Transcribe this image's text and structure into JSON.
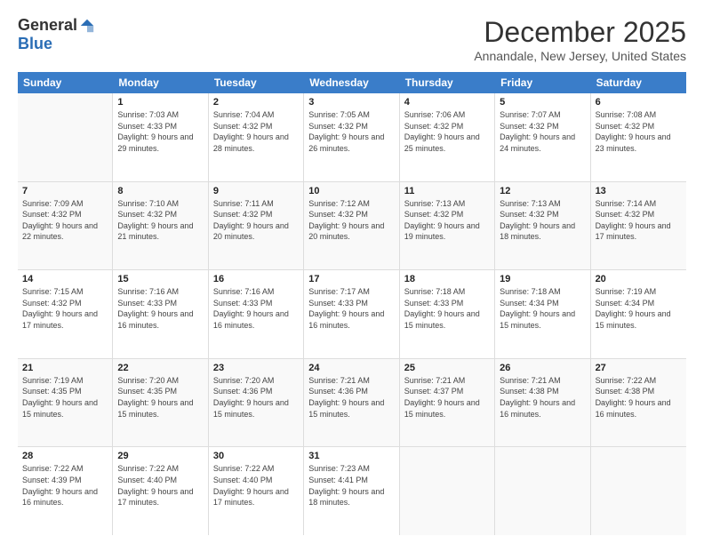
{
  "logo": {
    "general": "General",
    "blue": "Blue"
  },
  "title": "December 2025",
  "location": "Annandale, New Jersey, United States",
  "days_of_week": [
    "Sunday",
    "Monday",
    "Tuesday",
    "Wednesday",
    "Thursday",
    "Friday",
    "Saturday"
  ],
  "weeks": [
    [
      {
        "day": "",
        "sunrise": "",
        "sunset": "",
        "daylight": ""
      },
      {
        "day": "1",
        "sunrise": "7:03 AM",
        "sunset": "4:33 PM",
        "daylight": "9 hours and 29 minutes."
      },
      {
        "day": "2",
        "sunrise": "7:04 AM",
        "sunset": "4:32 PM",
        "daylight": "9 hours and 28 minutes."
      },
      {
        "day": "3",
        "sunrise": "7:05 AM",
        "sunset": "4:32 PM",
        "daylight": "9 hours and 26 minutes."
      },
      {
        "day": "4",
        "sunrise": "7:06 AM",
        "sunset": "4:32 PM",
        "daylight": "9 hours and 25 minutes."
      },
      {
        "day": "5",
        "sunrise": "7:07 AM",
        "sunset": "4:32 PM",
        "daylight": "9 hours and 24 minutes."
      },
      {
        "day": "6",
        "sunrise": "7:08 AM",
        "sunset": "4:32 PM",
        "daylight": "9 hours and 23 minutes."
      }
    ],
    [
      {
        "day": "7",
        "sunrise": "7:09 AM",
        "sunset": "4:32 PM",
        "daylight": "9 hours and 22 minutes."
      },
      {
        "day": "8",
        "sunrise": "7:10 AM",
        "sunset": "4:32 PM",
        "daylight": "9 hours and 21 minutes."
      },
      {
        "day": "9",
        "sunrise": "7:11 AM",
        "sunset": "4:32 PM",
        "daylight": "9 hours and 20 minutes."
      },
      {
        "day": "10",
        "sunrise": "7:12 AM",
        "sunset": "4:32 PM",
        "daylight": "9 hours and 20 minutes."
      },
      {
        "day": "11",
        "sunrise": "7:13 AM",
        "sunset": "4:32 PM",
        "daylight": "9 hours and 19 minutes."
      },
      {
        "day": "12",
        "sunrise": "7:13 AM",
        "sunset": "4:32 PM",
        "daylight": "9 hours and 18 minutes."
      },
      {
        "day": "13",
        "sunrise": "7:14 AM",
        "sunset": "4:32 PM",
        "daylight": "9 hours and 17 minutes."
      }
    ],
    [
      {
        "day": "14",
        "sunrise": "7:15 AM",
        "sunset": "4:32 PM",
        "daylight": "9 hours and 17 minutes."
      },
      {
        "day": "15",
        "sunrise": "7:16 AM",
        "sunset": "4:33 PM",
        "daylight": "9 hours and 16 minutes."
      },
      {
        "day": "16",
        "sunrise": "7:16 AM",
        "sunset": "4:33 PM",
        "daylight": "9 hours and 16 minutes."
      },
      {
        "day": "17",
        "sunrise": "7:17 AM",
        "sunset": "4:33 PM",
        "daylight": "9 hours and 16 minutes."
      },
      {
        "day": "18",
        "sunrise": "7:18 AM",
        "sunset": "4:33 PM",
        "daylight": "9 hours and 15 minutes."
      },
      {
        "day": "19",
        "sunrise": "7:18 AM",
        "sunset": "4:34 PM",
        "daylight": "9 hours and 15 minutes."
      },
      {
        "day": "20",
        "sunrise": "7:19 AM",
        "sunset": "4:34 PM",
        "daylight": "9 hours and 15 minutes."
      }
    ],
    [
      {
        "day": "21",
        "sunrise": "7:19 AM",
        "sunset": "4:35 PM",
        "daylight": "9 hours and 15 minutes."
      },
      {
        "day": "22",
        "sunrise": "7:20 AM",
        "sunset": "4:35 PM",
        "daylight": "9 hours and 15 minutes."
      },
      {
        "day": "23",
        "sunrise": "7:20 AM",
        "sunset": "4:36 PM",
        "daylight": "9 hours and 15 minutes."
      },
      {
        "day": "24",
        "sunrise": "7:21 AM",
        "sunset": "4:36 PM",
        "daylight": "9 hours and 15 minutes."
      },
      {
        "day": "25",
        "sunrise": "7:21 AM",
        "sunset": "4:37 PM",
        "daylight": "9 hours and 15 minutes."
      },
      {
        "day": "26",
        "sunrise": "7:21 AM",
        "sunset": "4:38 PM",
        "daylight": "9 hours and 16 minutes."
      },
      {
        "day": "27",
        "sunrise": "7:22 AM",
        "sunset": "4:38 PM",
        "daylight": "9 hours and 16 minutes."
      }
    ],
    [
      {
        "day": "28",
        "sunrise": "7:22 AM",
        "sunset": "4:39 PM",
        "daylight": "9 hours and 16 minutes."
      },
      {
        "day": "29",
        "sunrise": "7:22 AM",
        "sunset": "4:40 PM",
        "daylight": "9 hours and 17 minutes."
      },
      {
        "day": "30",
        "sunrise": "7:22 AM",
        "sunset": "4:40 PM",
        "daylight": "9 hours and 17 minutes."
      },
      {
        "day": "31",
        "sunrise": "7:23 AM",
        "sunset": "4:41 PM",
        "daylight": "9 hours and 18 minutes."
      },
      {
        "day": "",
        "sunrise": "",
        "sunset": "",
        "daylight": ""
      },
      {
        "day": "",
        "sunrise": "",
        "sunset": "",
        "daylight": ""
      },
      {
        "day": "",
        "sunrise": "",
        "sunset": "",
        "daylight": ""
      }
    ]
  ],
  "labels": {
    "sunrise": "Sunrise:",
    "sunset": "Sunset:",
    "daylight": "Daylight:"
  }
}
